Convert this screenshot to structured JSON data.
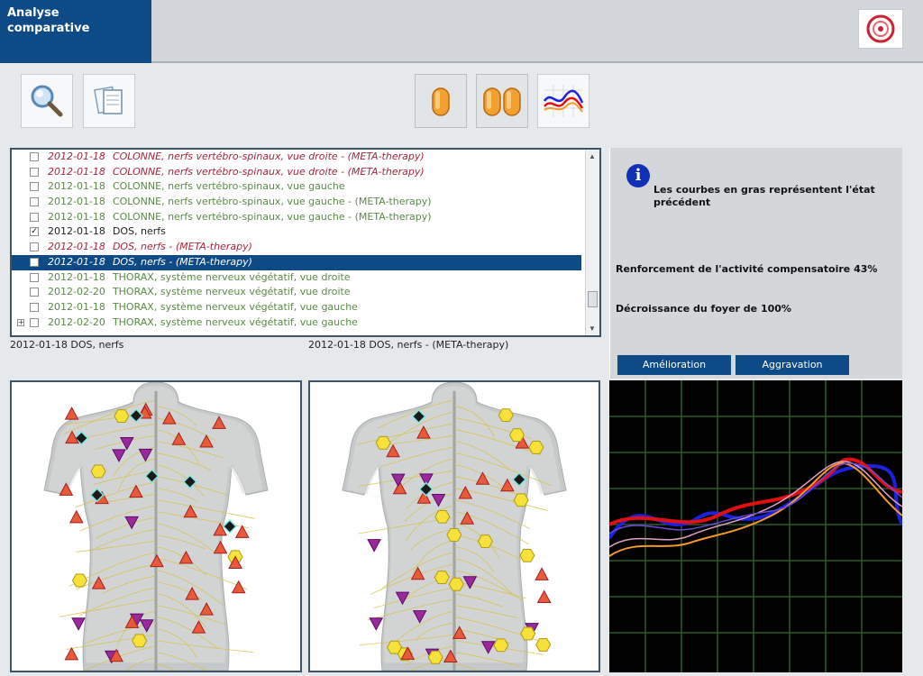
{
  "window": {
    "title": "Analyse comparative"
  },
  "toolbar": {
    "left_tools": [
      "magnifier-icon",
      "documents-icon"
    ],
    "right_tools": [
      "single-capsule-icon",
      "double-capsule-icon",
      "curves-chart-icon"
    ]
  },
  "list": {
    "rows": [
      {
        "date": "2012-01-18",
        "text": "COLONNE, nerfs vertébro-spinaux, vue droite - (META-therapy)",
        "style": "red",
        "checked": false
      },
      {
        "date": "2012-01-18",
        "text": "COLONNE, nerfs vertébro-spinaux, vue droite - (META-therapy)",
        "style": "red",
        "checked": false
      },
      {
        "date": "2012-01-18",
        "text": "COLONNE, nerfs vertébro-spinaux, vue gauche",
        "style": "green",
        "checked": false
      },
      {
        "date": "2012-01-18",
        "text": "COLONNE, nerfs vertébro-spinaux, vue gauche - (META-therapy)",
        "style": "green",
        "checked": false
      },
      {
        "date": "2012-01-18",
        "text": "COLONNE, nerfs vertébro-spinaux, vue gauche - (META-therapy)",
        "style": "green",
        "checked": false
      },
      {
        "date": "2012-01-18",
        "text": "DOS, nerfs",
        "style": "black",
        "checked": true
      },
      {
        "date": "2012-01-18",
        "text": "DOS, nerfs - (META-therapy)",
        "style": "red",
        "checked": false
      },
      {
        "date": "2012-01-18",
        "text": "DOS, nerfs - (META-therapy)",
        "style": "selected",
        "checked": false
      },
      {
        "date": "2012-01-18",
        "text": "THORAX, système nerveux végétatif, vue droite",
        "style": "green",
        "checked": false
      },
      {
        "date": "2012-02-20",
        "text": "THORAX, système nerveux végétatif, vue droite",
        "style": "green",
        "checked": false
      },
      {
        "date": "2012-01-18",
        "text": "THORAX, système nerveux végétatif, vue gauche",
        "style": "green",
        "checked": false
      },
      {
        "date": "2012-02-20",
        "text": "THORAX, système nerveux végétatif, vue gauche",
        "style": "green",
        "checked": false
      }
    ]
  },
  "captions": {
    "left": "2012-01-18  DOS, nerfs",
    "right": "2012-01-18  DOS, nerfs - (META-therapy)"
  },
  "info": {
    "icon": "info-icon",
    "note": "Les courbes en gras représentent l'état précédent",
    "stat1": "Renforcement de l'activité compensatoire 43%",
    "stat2": "Décroissance du foyer de 100%",
    "btn_improve": "Amélioration",
    "btn_worsen": "Aggravation"
  },
  "colors": {
    "accent": "#0d4a86",
    "graph_bg": "#000000",
    "grid": "#2f5b2a",
    "curve_blue": "#1a22e0",
    "curve_red": "#e01010",
    "curve_orange": "#f39a2a",
    "curve_pink": "#e0a0c8"
  }
}
